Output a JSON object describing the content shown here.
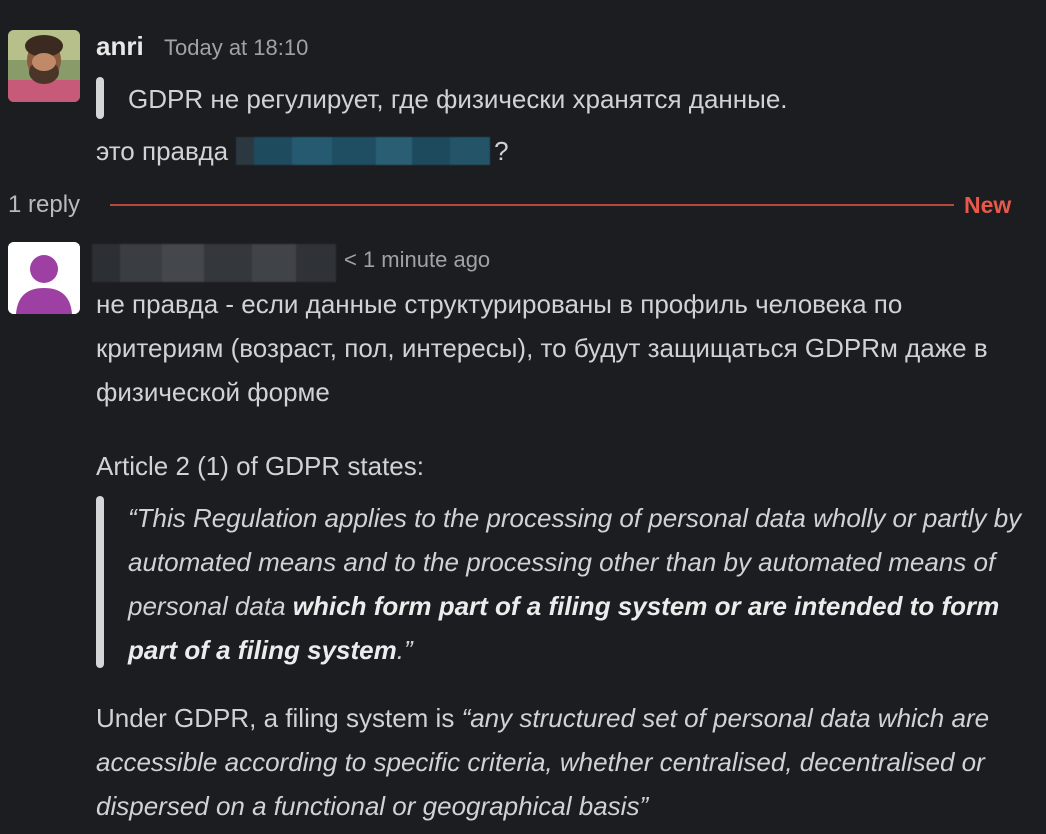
{
  "message1": {
    "sender": "anri",
    "timestamp": "Today at 18:10",
    "quote": "GDPR не регулирует, где физически хранятся данные.",
    "text_before_mention": "это правда",
    "text_after_mention": "?"
  },
  "thread": {
    "reply_count": "1 reply",
    "new_label": "New",
    "new_color": "#e9594b"
  },
  "message2": {
    "time_ago": "< 1 minute ago",
    "body": "не правда - если данные структурированы в профиль человека по критериям (возраст, пол, интересы), то будут защищаться GDPRм даже в физической форме",
    "article_intro": "Article 2 (1) of GDPR states:",
    "quote_plain": "“This Regulation applies to the processing of personal data wholly or partly by automated means and to the processing other than by automated means of personal data ",
    "quote_bold": "which form part of a filing system or are intended to form part of a filing system",
    "quote_end": ".”",
    "definition_plain": "Under GDPR, a filing system is ",
    "definition_italic": "“any structured set of personal data which are accessible according to specific criteria, whether centralised, decentralised or dispersed on a functional or geographical basis”"
  }
}
